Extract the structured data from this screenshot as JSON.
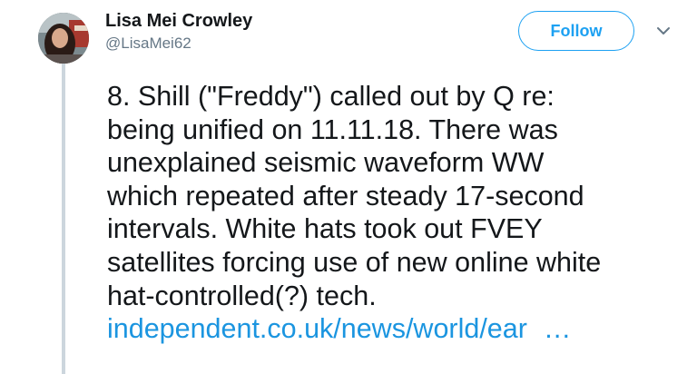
{
  "author": {
    "name": "Lisa Mei Crowley",
    "handle": "@LisaMei62"
  },
  "follow_button": {
    "label": "Follow"
  },
  "menu": {
    "icon": "chevron-down-icon"
  },
  "tweet": {
    "lines": [
      "8. Shill (\"Freddy\") called out by Q re:",
      "being unified on 11.11.18. There was",
      "unexplained seismic waveform WW",
      "which repeated after steady 17-second",
      "intervals. White hats took out FVEY",
      "satellites forcing use of new online white",
      "hat-controlled(?) tech."
    ],
    "link": {
      "text": "independent.co.uk/news/world/ear",
      "ellipsis": "…"
    }
  },
  "colors": {
    "accent": "#1da1f2",
    "link": "#1b95e0",
    "thread_line": "#ccd6dd",
    "muted": "#657786"
  }
}
